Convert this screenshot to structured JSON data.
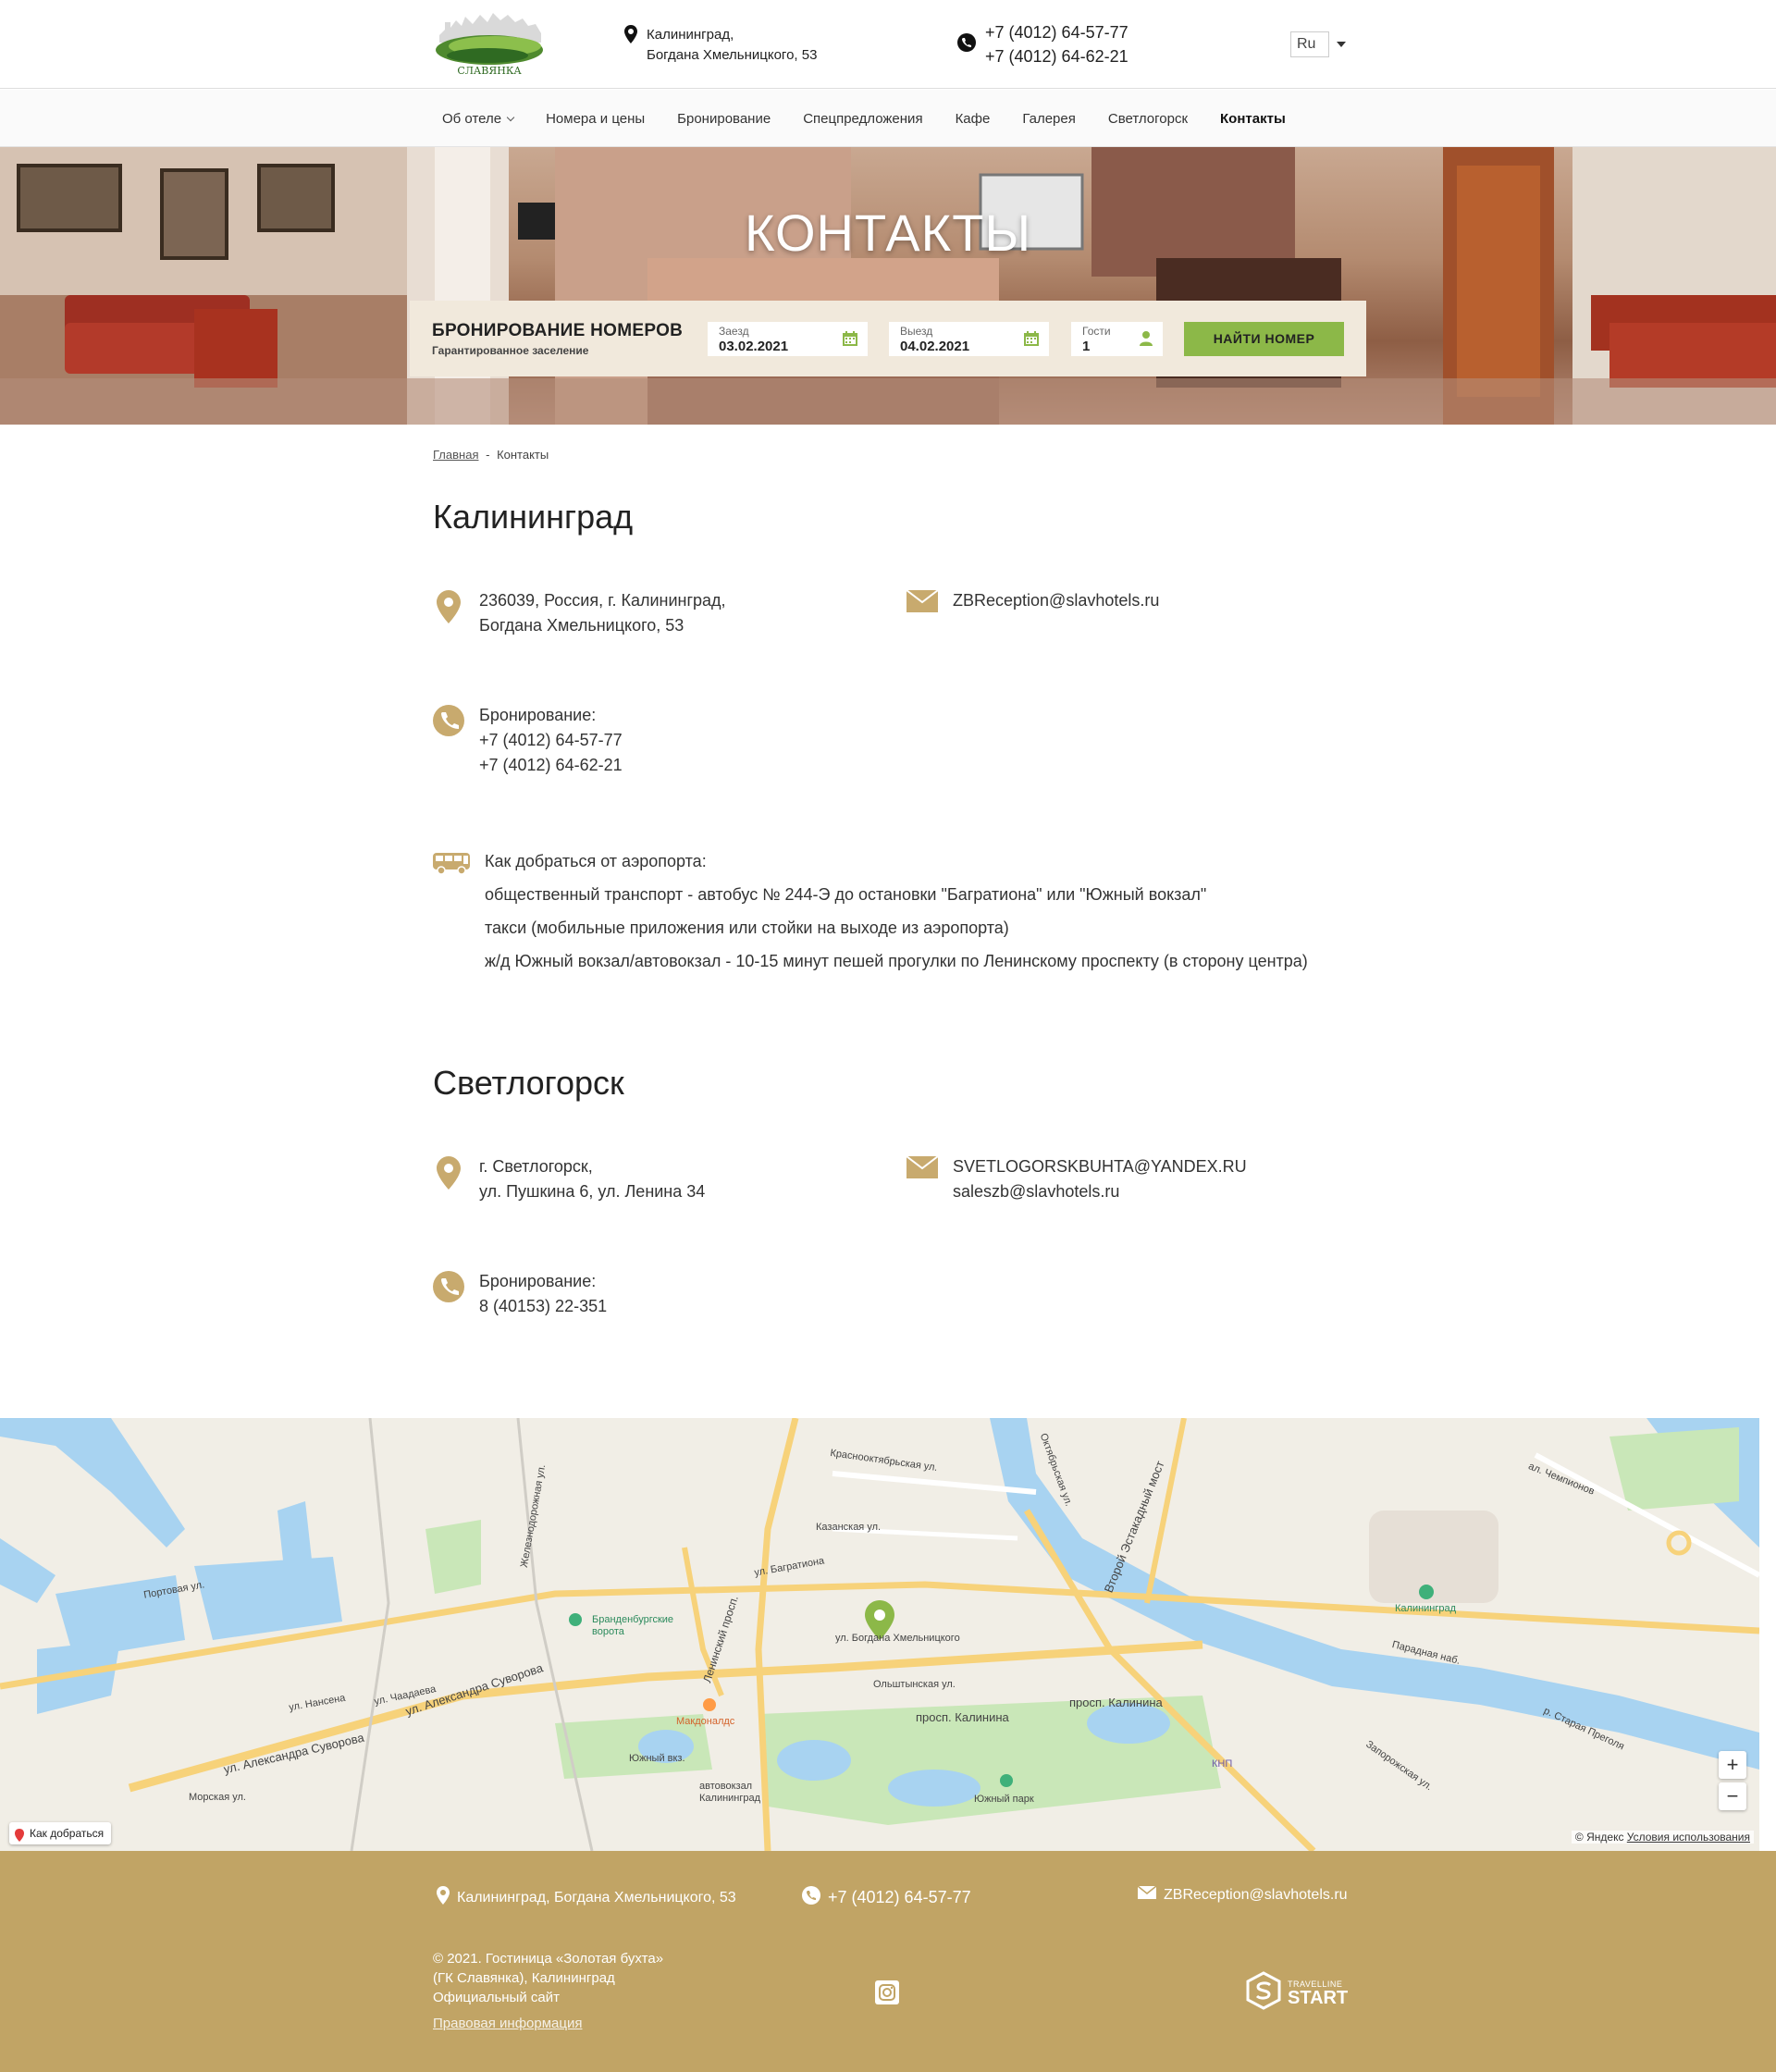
{
  "header": {
    "address_line1": "Калининград,",
    "address_line2": "Богдана Хмельницкого, 53",
    "phone1": "+7 (4012) 64-57-77",
    "phone2": "+7 (4012) 64-62-21",
    "lang": "Ru",
    "logo_text": "СЛАВЯНКА"
  },
  "nav": {
    "items": [
      {
        "label": "Об отеле"
      },
      {
        "label": "Номера и цены"
      },
      {
        "label": "Бронирование"
      },
      {
        "label": "Спецпредложения"
      },
      {
        "label": "Кафе"
      },
      {
        "label": "Галерея"
      },
      {
        "label": "Светлогорск"
      },
      {
        "label": "Контакты"
      }
    ]
  },
  "hero": {
    "title": "КОНТАКТЫ"
  },
  "booking": {
    "title": "БРОНИРОВАНИЕ НОМЕРОВ",
    "subtitle": "Гарантированное заселение",
    "checkin_label": "Заезд",
    "checkin_value": "03.02.2021",
    "checkout_label": "Выезд",
    "checkout_value": "04.02.2021",
    "guests_label": "Гости",
    "guests_value": "1",
    "button": "НАЙТИ НОМЕР"
  },
  "breadcrumb": {
    "home": "Главная",
    "sep": "-",
    "current": "Контакты"
  },
  "kaliningrad": {
    "title": "Калининград",
    "address1": "236039, Россия, г. Калининград,",
    "address2": "Богдана Хмельницкого, 53",
    "email": "ZBReception@slavhotels.ru",
    "booking_label": "Бронирование:",
    "phone1": "+7 (4012) 64-57-77",
    "phone2": "+7 (4012) 64-62-21",
    "howto_title": "Как добраться от аэропорта:",
    "howto_1": "общественный транспорт - автобус № 244-Э до остановки \"Багратиона\" или \"Южный вокзал\"",
    "howto_2": "такси (мобильные приложения или стойки на выходе из аэропорта)",
    "howto_3": "ж/д Южный вокзал/автовокзал - 10-15 минут пешей прогулки по Ленинскому проспекту (в сторону центра)"
  },
  "svetlogorsk": {
    "title": "Светлогорск",
    "address1": "г. Светлогорск,",
    "address2": "ул. Пушкина 6, ул. Ленина 34",
    "email1": "SVETLOGORSKBUHTA@YANDEX.RU",
    "email2": "saleszb@slavhotels.ru",
    "booking_label": "Бронирование:",
    "phone": "8 (40153) 22-351"
  },
  "map": {
    "route": "Как добраться",
    "copyright": "© Яндекс",
    "terms": "Условия использования",
    "zoom_in": "+",
    "zoom_out": "−",
    "labels": {
      "l1": "ул. Богдана Хмельницкого",
      "l2": "просп. Калинина",
      "l3": "просп. Калинина",
      "l4": "ул. Александра Суворова",
      "l5": "ул. Александра Суворова",
      "l6": "Ленинский просп.",
      "l7": "ул. Багратиона",
      "l8": "Южный парк",
      "l9": "Бранденбургские ворота",
      "l10": "Калининград",
      "l11": "Южный вкз.",
      "l12": "автовокзал Калининград",
      "l13": "Макдоналдс",
      "l14": "Портовая ул.",
      "l15": "Краснооктябрьская ул.",
      "l16": "Второй Эстакадный мост",
      "l17": "р. Старая Преголя",
      "l18": "ал. Чемпионов",
      "l19": "Железнодорожная ул.",
      "l20": "Казанская ул.",
      "l21": "Ольштынская ул.",
      "l22": "Парадная наб.",
      "l23": "Октябрьская ул.",
      "l24": "КНП",
      "l25": "ул. Чаадаева",
      "l26": "ул. Нансена",
      "l27": "Морская ул.",
      "l28": "Запорожская ул."
    }
  },
  "footer": {
    "address": "Калининград, Богдана Хмельницкого, 53",
    "phone": "+7 (4012) 64-57-77",
    "email": "ZBReception@slavhotels.ru",
    "copy1": "© 2021. Гостиница «Золотая бухта»",
    "copy2": "(ГК Славянка), Калининград",
    "copy3": "Официальный сайт",
    "legal": "Правовая информация",
    "tl_small": "TRAVELLINE",
    "tl_big": "START"
  },
  "colors": {
    "gold": "#c1a465",
    "green": "#8cb848",
    "icon_gold": "#c8aa6e"
  }
}
